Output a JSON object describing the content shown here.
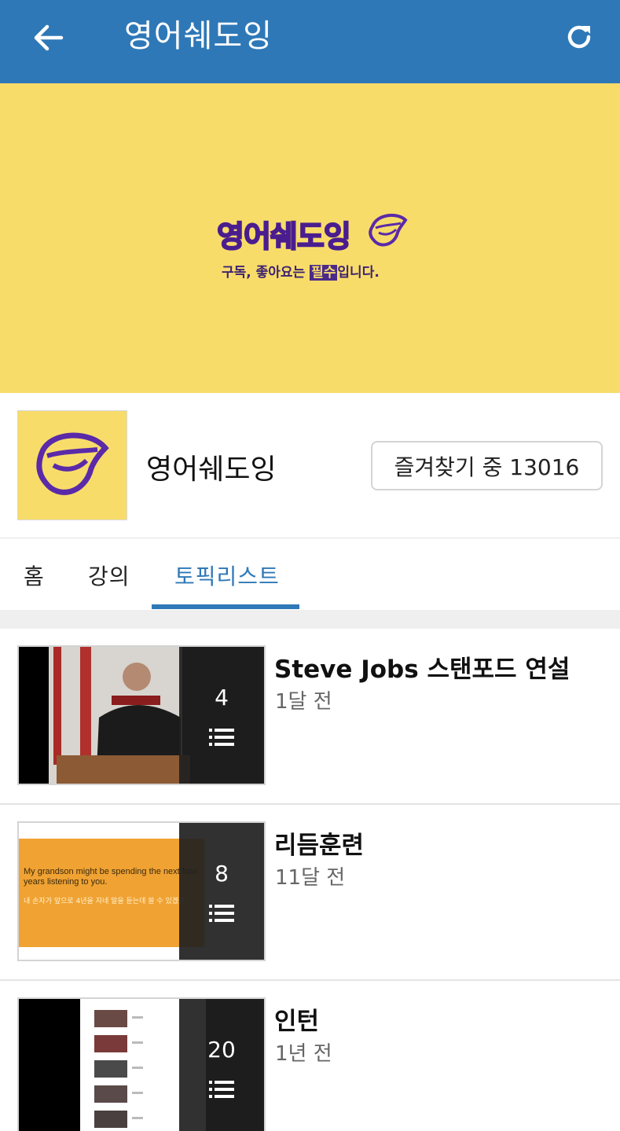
{
  "appbar": {
    "title": "영어쉐도잉"
  },
  "banner": {
    "logo_text": "영어쉐도잉",
    "tagline_before": "구독, 좋아요는 ",
    "tagline_highlight": "필수",
    "tagline_after": "입니다."
  },
  "channel": {
    "name": "영어쉐도잉",
    "favorite_label": "즐겨찾기 중 13016"
  },
  "tabs": [
    {
      "label": "홈",
      "active": false
    },
    {
      "label": "강의",
      "active": false
    },
    {
      "label": "토픽리스트",
      "active": true
    }
  ],
  "playlists": [
    {
      "title": "Steve Jobs 스탠포드 연설",
      "date": "1달 전",
      "count": "4"
    },
    {
      "title": "리듬훈련",
      "date": "11달 전",
      "count": "8",
      "thumb_text_en": "My grandson might be spending the next four years listening to you.",
      "thumb_text_ko": "내 손자가 앞으로 4년을 자네 말을 듣는데 쓸 수 있겠군"
    },
    {
      "title": "인턴",
      "date": "1년 전",
      "count": "20"
    }
  ],
  "colors": {
    "appbar": "#2f78b7",
    "banner": "#f8dc6a",
    "accent": "#2f78b7",
    "logo_purple": "#4b2a8a"
  },
  "icons": [
    "back-arrow-icon",
    "refresh-icon",
    "lips-logo-icon",
    "playlist-icon"
  ]
}
